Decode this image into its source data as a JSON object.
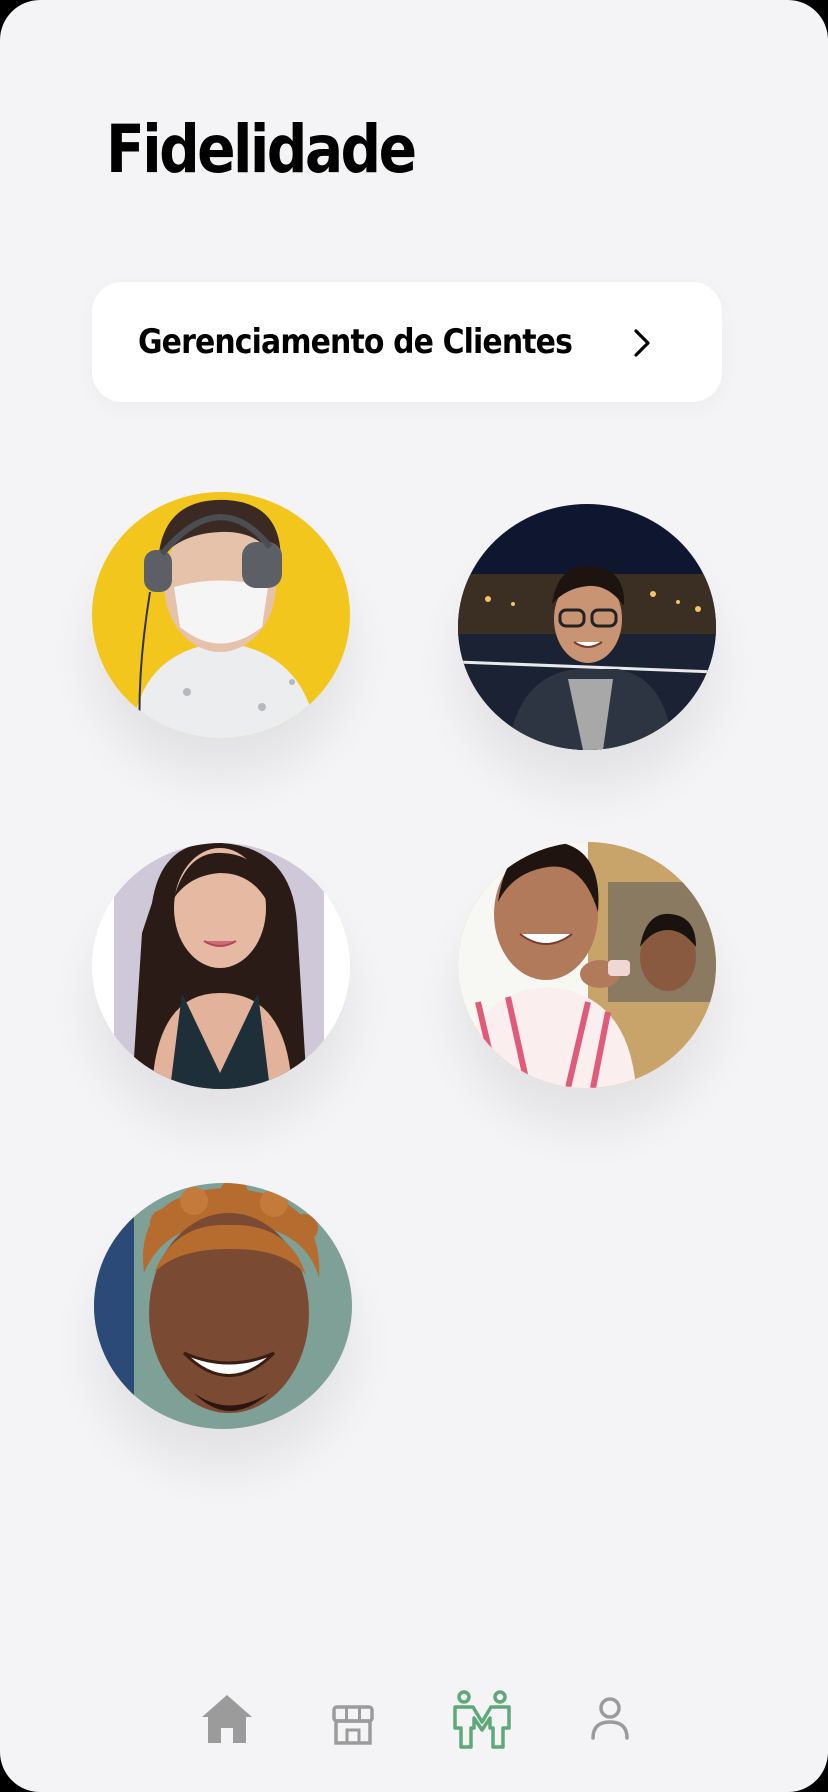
{
  "page": {
    "title": "Fidelidade"
  },
  "manage_card": {
    "label": "Gerenciamento de Clientes",
    "icon": "chevron-right-icon"
  },
  "clients": [
    {
      "name": "client-avatar-1",
      "bg": "#f2c61d"
    },
    {
      "name": "client-avatar-2",
      "bg": "#0f1630"
    },
    {
      "name": "client-avatar-3",
      "bg": "#ffffff"
    },
    {
      "name": "client-avatar-4",
      "bg": "#e8b23a"
    },
    {
      "name": "client-avatar-5",
      "bg": "#7fa096"
    }
  ],
  "tabbar": {
    "items": [
      {
        "icon": "home-icon",
        "active": false
      },
      {
        "icon": "store-icon",
        "active": false
      },
      {
        "icon": "loyalty-people-icon",
        "active": true
      },
      {
        "icon": "profile-icon",
        "active": false
      }
    ],
    "active_color": "#5fa878",
    "inactive_color": "#9b9b9b"
  }
}
